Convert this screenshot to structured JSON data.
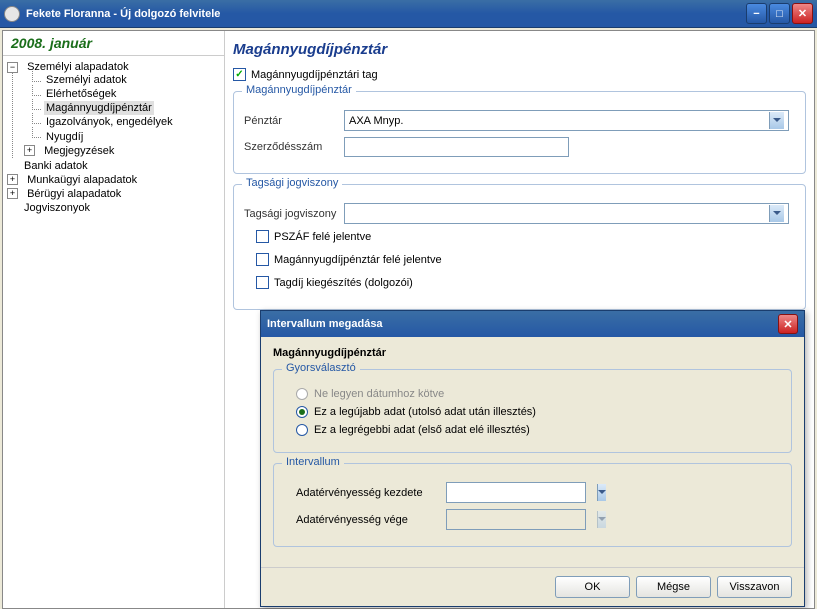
{
  "window": {
    "title": "Fekete Floranna - Új dolgozó felvitele"
  },
  "date_header": "2008. január",
  "tree": {
    "n0": {
      "label": "Személyi alapadatok"
    },
    "n0_0": {
      "label": "Személyi adatok"
    },
    "n0_1": {
      "label": "Elérhetőségek"
    },
    "n0_2": {
      "label": "Magánnyugdíjpénztár"
    },
    "n0_3": {
      "label": "Igazolványok, engedélyek"
    },
    "n0_4": {
      "label": "Nyugdíj"
    },
    "n0_5": {
      "label": "Megjegyzések"
    },
    "n1": {
      "label": "Banki adatok"
    },
    "n2": {
      "label": "Munkaügyi alapadatok"
    },
    "n3": {
      "label": "Bérügyi alapadatok"
    },
    "n4": {
      "label": "Jogviszonyok"
    }
  },
  "panel": {
    "title": "Magánnyugdíjpénztár",
    "member_chk": "Magánnyugdíjpénztári tag",
    "fs1_legend": "Magánnyugdíjpénztár",
    "penztar_label": "Pénztár",
    "penztar_value": "AXA Mnyp.",
    "szerzodes_label": "Szerződésszám",
    "szerzodes_value": "",
    "fs2_legend": "Tagsági jogviszony",
    "tagsagi_label": "Tagsági jogviszony",
    "tagsagi_value": "",
    "chk_pszaf": "PSZÁF felé jelentve",
    "chk_mnyp": "Magánnyugdíjpénztár felé jelentve",
    "chk_tagdij": "Tagdíj kiegészítés (dolgozói)"
  },
  "dialog": {
    "title": "Intervallum megadása",
    "subtitle": "Magánnyugdíjpénztár",
    "fs_gyors": "Gyorsválasztó",
    "r0": "Ne legyen dátumhoz kötve",
    "r1": "Ez a legújabb adat (utolsó adat után illesztés)",
    "r2": "Ez a legrégebbi adat (első adat elé illesztés)",
    "fs_interval": "Intervallum",
    "kezdete_label": "Adatérvényesség kezdete",
    "kezdete_value": "",
    "vege_label": "Adatérvényesség vége",
    "vege_value": "",
    "btn_ok": "OK",
    "btn_cancel": "Mégse",
    "btn_undo": "Visszavon"
  }
}
